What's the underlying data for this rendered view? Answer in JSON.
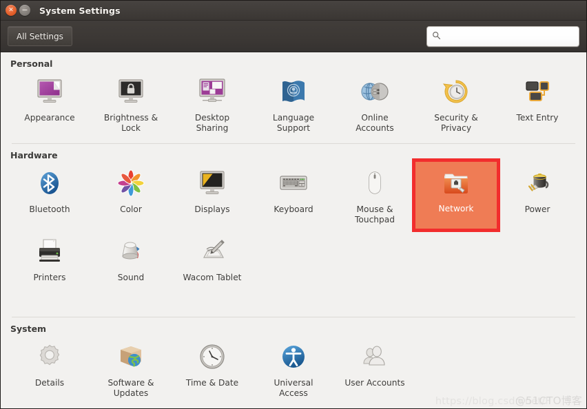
{
  "window": {
    "title": "System Settings",
    "close_glyph": "✕",
    "minimize_glyph": "−"
  },
  "toolbar": {
    "all_settings_label": "All Settings",
    "search_value": "",
    "search_placeholder": ""
  },
  "sections": [
    {
      "id": "personal",
      "title": "Personal",
      "rows": [
        [
          {
            "label": "Appearance",
            "icon": "appearance-icon",
            "highlighted": false
          },
          {
            "label": "Brightness &\nLock",
            "icon": "brightness-lock-icon",
            "highlighted": false
          },
          {
            "label": "Desktop\nSharing",
            "icon": "desktop-sharing-icon",
            "highlighted": false
          },
          {
            "label": "Language\nSupport",
            "icon": "language-support-icon",
            "highlighted": false
          },
          {
            "label": "Online\nAccounts",
            "icon": "online-accounts-icon",
            "highlighted": false
          },
          {
            "label": "Security &\nPrivacy",
            "icon": "security-privacy-icon",
            "highlighted": false
          },
          {
            "label": "Text Entry",
            "icon": "text-entry-icon",
            "highlighted": false
          }
        ]
      ]
    },
    {
      "id": "hardware",
      "title": "Hardware",
      "rows": [
        [
          {
            "label": "Bluetooth",
            "icon": "bluetooth-icon",
            "highlighted": false
          },
          {
            "label": "Color",
            "icon": "color-icon",
            "highlighted": false
          },
          {
            "label": "Displays",
            "icon": "displays-icon",
            "highlighted": false
          },
          {
            "label": "Keyboard",
            "icon": "keyboard-icon",
            "highlighted": false
          },
          {
            "label": "Mouse &\nTouchpad",
            "icon": "mouse-touchpad-icon",
            "highlighted": false
          },
          {
            "label": "Network",
            "icon": "network-icon",
            "highlighted": true
          },
          {
            "label": "Power",
            "icon": "power-icon",
            "highlighted": false
          }
        ],
        [
          {
            "label": "Printers",
            "icon": "printers-icon",
            "highlighted": false
          },
          {
            "label": "Sound",
            "icon": "sound-icon",
            "highlighted": false
          },
          {
            "label": "Wacom Tablet",
            "icon": "wacom-tablet-icon",
            "highlighted": false
          }
        ]
      ]
    },
    {
      "id": "system",
      "title": "System",
      "rows": [
        [
          {
            "label": "Details",
            "icon": "details-icon",
            "highlighted": false
          },
          {
            "label": "Software &\nUpdates",
            "icon": "software-updates-icon",
            "highlighted": false
          },
          {
            "label": "Time & Date",
            "icon": "time-date-icon",
            "highlighted": false
          },
          {
            "label": "Universal\nAccess",
            "icon": "universal-access-icon",
            "highlighted": false
          },
          {
            "label": "User Accounts",
            "icon": "user-accounts-icon",
            "highlighted": false
          }
        ]
      ]
    }
  ],
  "watermark": {
    "url": "https://blog.csdn.net/F",
    "cto": "@51CTO博客"
  },
  "colors": {
    "highlight_border": "#f22d2d",
    "highlight_fill": "#ef7c55",
    "titlebar": "#413d3a",
    "content_bg": "#f2f1ef",
    "close_button": "#e4612c"
  }
}
